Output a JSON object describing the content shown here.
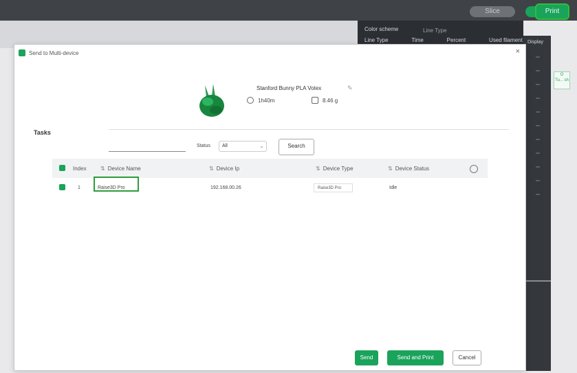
{
  "topbar": {
    "grey_button_label": "Slice",
    "print_button_label": "Print"
  },
  "background": {
    "color_scheme_label": "Color scheme",
    "line_type_label": "Line Type",
    "columns": [
      "Line Type",
      "Time",
      "Percent",
      "Used filament",
      "Display"
    ],
    "side_tip": [
      "O",
      "Tu... sh"
    ]
  },
  "dialog": {
    "title": "Send to Multi-device",
    "close_icon": "×",
    "model_name": "Stanford Bunny PLA Votex",
    "print_time": "1h40m",
    "filament_weight": "8.46 g",
    "tasks_label": "Tasks",
    "status_label": "Status",
    "status_value": "All",
    "search_label": "Search",
    "columns": [
      "Index",
      "Device Name",
      "Device Ip",
      "Device Type",
      "Device Status"
    ],
    "rows": [
      {
        "index": "1",
        "device_name": "Raise3D Pro",
        "device_ip": "192.168.00.26",
        "device_type": "Raise3D Pro",
        "device_status": "Idle"
      }
    ],
    "buttons": {
      "send": "Send",
      "save_and_print": "Send and Print",
      "cancel": "Cancel"
    }
  },
  "colors": {
    "accent": "#1aa35a",
    "highlight_outline": "#2a9d3a",
    "topbar_bg": "#3f4246"
  }
}
